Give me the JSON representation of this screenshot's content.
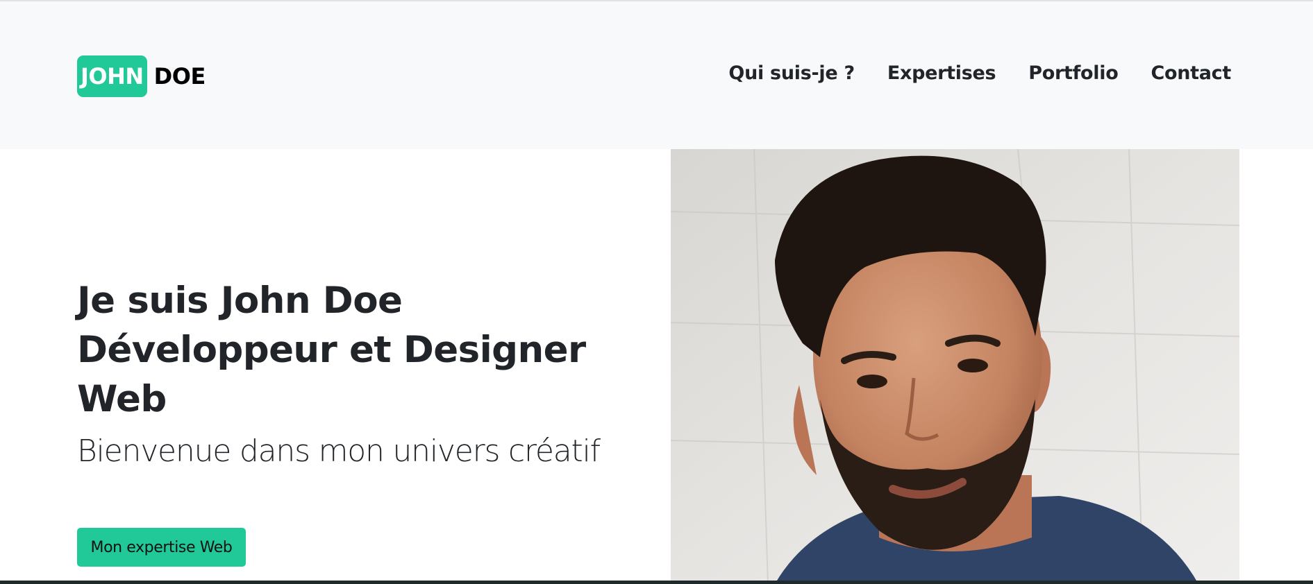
{
  "brand": {
    "first": "JOHN",
    "last": "DOE"
  },
  "nav": {
    "items": [
      {
        "label": "Qui suis-je ?"
      },
      {
        "label": "Expertises"
      },
      {
        "label": "Portfolio"
      },
      {
        "label": "Contact"
      }
    ]
  },
  "hero": {
    "title_lines": [
      "Je suis John Doe",
      "Développeur et Designer",
      "Web"
    ],
    "subtitle": "Bienvenue dans mon univers créatif",
    "cta_label": "Mon expertise Web"
  },
  "colors": {
    "accent": "#20c997",
    "navbar_bg": "#f8f9fa",
    "text": "#212529"
  }
}
